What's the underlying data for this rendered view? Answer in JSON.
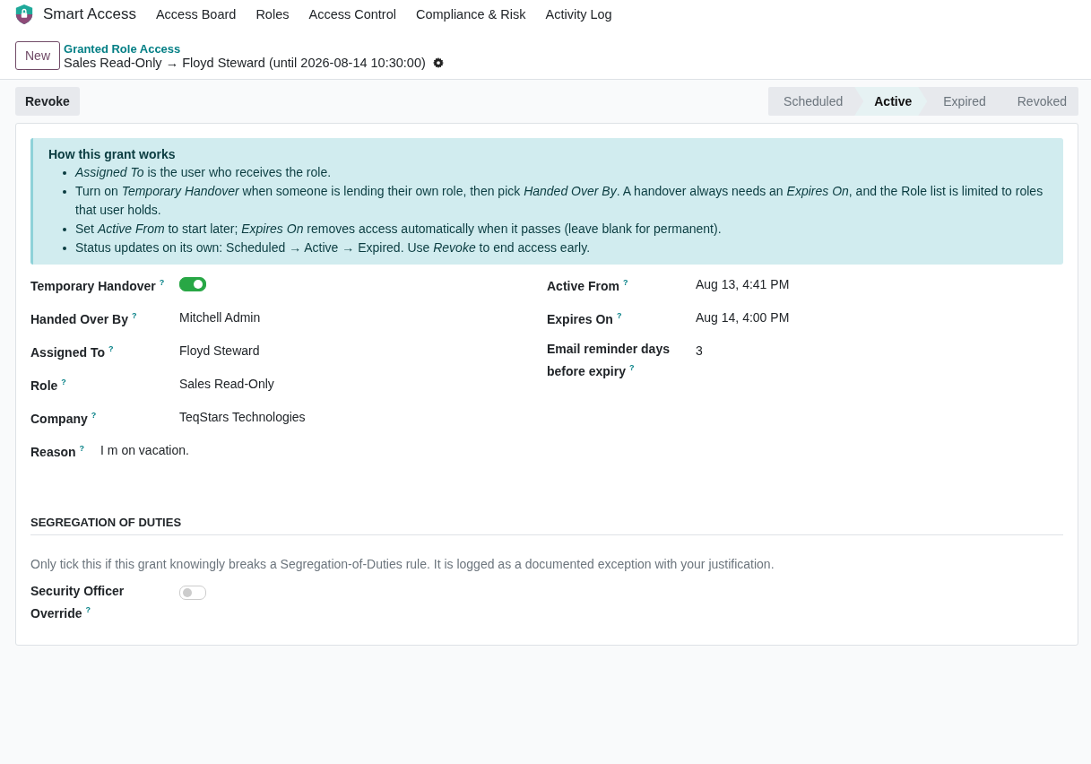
{
  "app": {
    "name": "Smart Access"
  },
  "menu": [
    "Access Board",
    "Roles",
    "Access Control",
    "Compliance & Risk",
    "Activity Log"
  ],
  "breadcrumb": {
    "new_button": "New",
    "parent": "Granted Role Access",
    "record": "Sales Read-Only → Floyd Steward (until 2026-08-14 10:30:00)"
  },
  "actions": [
    "Revoke"
  ],
  "stages": [
    {
      "label": "Scheduled",
      "selected": false
    },
    {
      "label": "Active",
      "selected": true
    },
    {
      "label": "Expired",
      "selected": false
    },
    {
      "label": "Revoked",
      "selected": false
    }
  ],
  "info": {
    "title": "How this grant works",
    "items": [
      "*Assigned To* is the user who receives the role.",
      "Turn on *Temporary Handover* when someone is lending their own role, then pick *Handed Over By*. A handover always needs an *Expires On*, and the Role list is limited to roles that user holds.",
      "Set *Active From* to start later; *Expires On* removes access automatically when it passes (leave blank for permanent).",
      "Status updates on its own: Scheduled → Active → Expired. Use *Revoke* to end access early."
    ]
  },
  "left_fields": [
    {
      "kind": "toggle",
      "label": "Temporary Handover",
      "help": "?",
      "checked": true
    },
    {
      "kind": "text",
      "label": "Handed Over By",
      "help": "?",
      "value": "Mitchell Admin"
    },
    {
      "kind": "text",
      "label": "Assigned To",
      "help": "?",
      "value": "Floyd Steward"
    },
    {
      "kind": "text",
      "label": "Role",
      "help": "?",
      "value": "Sales Read-Only"
    },
    {
      "kind": "text",
      "label": "Company",
      "help": "?",
      "value": "TeqStars Technologies"
    },
    {
      "kind": "inline",
      "label": "Reason",
      "help": "?",
      "value": "I m on vacation."
    }
  ],
  "right_fields": [
    {
      "label": "Active From",
      "help": "?",
      "value": "Aug 13, 4:41 PM"
    },
    {
      "label": "Expires On",
      "help": "?",
      "value": "Aug 14, 4:00 PM"
    },
    {
      "label": "Email reminder days before expiry",
      "help": "?",
      "value": "3"
    }
  ],
  "segregation": {
    "heading": "SEGREGATION OF DUTIES",
    "note": "Only tick this if this grant knowingly breaks a Segregation-of-Duties rule. It is logged as a documented exception with your justification.",
    "fields": [
      {
        "kind": "toggle",
        "label": "Security Officer Override",
        "help": "?",
        "checked": false
      }
    ]
  }
}
